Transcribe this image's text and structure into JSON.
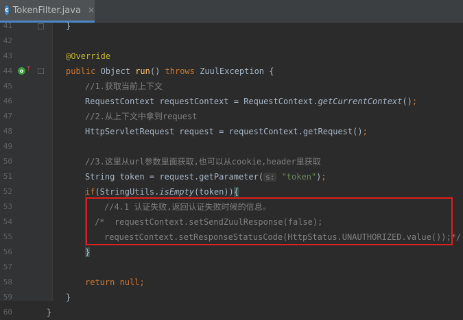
{
  "tab": {
    "icon": "c",
    "title": "TokenFilter.java",
    "close": "✕"
  },
  "lines": [
    {
      "no": "41",
      "segs": [
        {
          "t": "}",
          "c": ""
        }
      ],
      "indent": 96
    },
    {
      "no": "42",
      "segs": [],
      "indent": 96
    },
    {
      "no": "43",
      "segs": [
        {
          "t": "@Override",
          "c": "a"
        }
      ],
      "indent": 96
    },
    {
      "no": "44",
      "segs": [
        {
          "t": "public ",
          "c": "k"
        },
        {
          "t": "Object ",
          "c": ""
        },
        {
          "t": "run",
          "c": "fn"
        },
        {
          "t": "() ",
          "c": ""
        },
        {
          "t": "throws ",
          "c": "k"
        },
        {
          "t": "ZuulException {",
          "c": ""
        }
      ],
      "indent": 96
    },
    {
      "no": "45",
      "segs": [
        {
          "t": "//1.获取当前上下文",
          "c": "cm"
        }
      ],
      "indent": 124
    },
    {
      "no": "46",
      "segs": [
        {
          "t": "RequestContext requestContext = RequestContext.",
          "c": ""
        },
        {
          "t": "getCurrentContext",
          "c": "it"
        },
        {
          "t": "()",
          "c": ""
        },
        {
          "t": ";",
          "c": "k"
        }
      ],
      "indent": 124
    },
    {
      "no": "47",
      "segs": [
        {
          "t": "//2.从上下文中拿到request",
          "c": "cm"
        }
      ],
      "indent": 124
    },
    {
      "no": "48",
      "segs": [
        {
          "t": "HttpServletRequest request = requestContext.getRequest()",
          "c": ""
        },
        {
          "t": ";",
          "c": "k"
        }
      ],
      "indent": 124
    },
    {
      "no": "49",
      "segs": [],
      "indent": 124
    },
    {
      "no": "50",
      "segs": [
        {
          "t": "//3.这里从url参数里面获取,也可以从cookie,header里获取",
          "c": "cm"
        }
      ],
      "indent": 124
    },
    {
      "no": "51",
      "segs": [
        {
          "t": "String token = request.getParameter(",
          "c": ""
        },
        {
          "t": "s:",
          "c": "hint"
        },
        {
          "t": " ",
          "c": ""
        },
        {
          "t": "\"token\"",
          "c": "st"
        },
        {
          "t": ")",
          "c": ""
        },
        {
          "t": ";",
          "c": "k"
        }
      ],
      "indent": 124
    },
    {
      "no": "52",
      "segs": [
        {
          "t": "if",
          "c": "k"
        },
        {
          "t": "(StringUtils.",
          "c": ""
        },
        {
          "t": "isEmpty",
          "c": "it"
        },
        {
          "t": "(token))",
          "c": ""
        },
        {
          "t": "{",
          "c": "brace"
        }
      ],
      "indent": 124
    },
    {
      "no": "53",
      "segs": [
        {
          "t": "//4.1 认证失败,返回认证失败时候的信息。",
          "c": "cm"
        }
      ],
      "indent": 152
    },
    {
      "no": "54",
      "segs": [
        {
          "t": "/*  requestContext.setSendZuulResponse(false);",
          "c": "cm"
        }
      ],
      "indent": 138
    },
    {
      "no": "55",
      "segs": [
        {
          "t": "requestContext.setResponseStatusCode(HttpStatus.UNAUTHORIZED.value());*/",
          "c": "cm"
        }
      ],
      "indent": 152
    },
    {
      "no": "56",
      "segs": [
        {
          "t": "}",
          "c": "brace"
        }
      ],
      "indent": 124
    },
    {
      "no": "57",
      "segs": [],
      "indent": 124
    },
    {
      "no": "58",
      "segs": [
        {
          "t": "return ",
          "c": "k"
        },
        {
          "t": "null",
          "c": "k"
        },
        {
          "t": ";",
          "c": "k"
        }
      ],
      "indent": 124
    },
    {
      "no": "59",
      "segs": [
        {
          "t": "}",
          "c": ""
        }
      ],
      "indent": 96
    },
    {
      "no": "60",
      "segs": [
        {
          "t": "}",
          "c": ""
        }
      ],
      "indent": 68
    }
  ]
}
